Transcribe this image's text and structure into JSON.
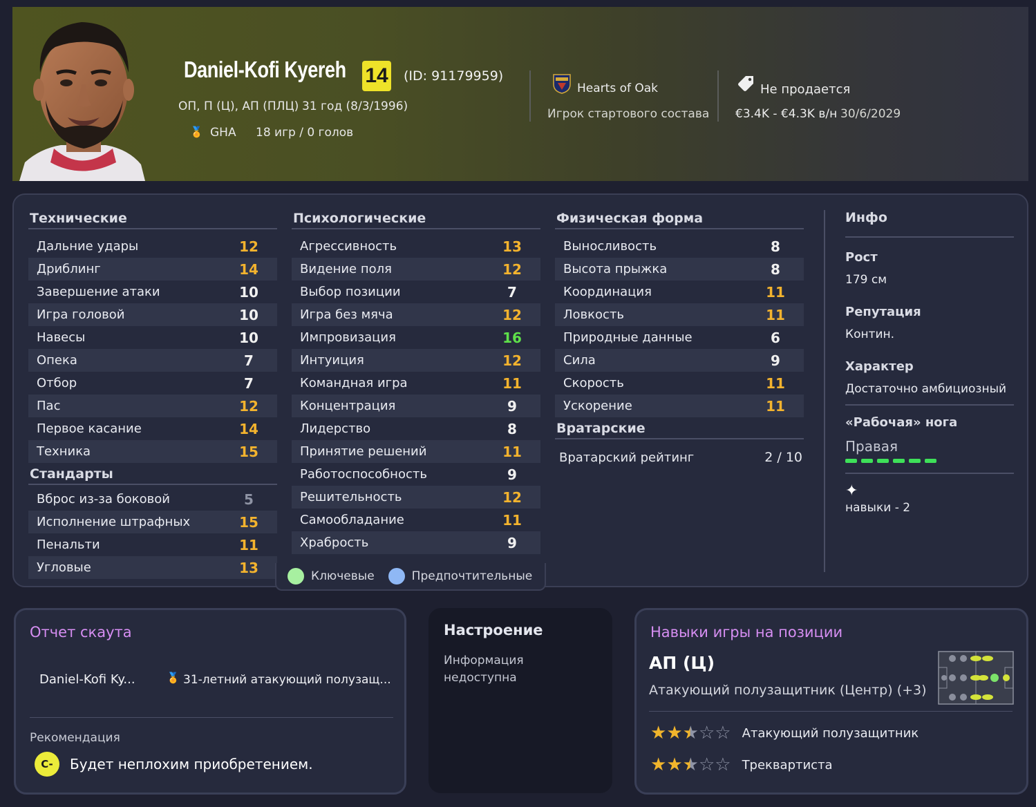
{
  "player": {
    "name": "Daniel-Kofi Kyereh",
    "number": "14",
    "id": "(ID: 91179959)",
    "positions": "ОП, П (Ц), АП (ПЛЦ)",
    "age": "31 год (8/3/1996)",
    "nation": "GHA",
    "caps": "18 игр / 0 голов"
  },
  "club": {
    "name": "Hearts of Oak",
    "squad_status": "Игрок стартового состава"
  },
  "transfer": {
    "status": "Не продается",
    "wage": "€3.4K - €4.3K  в/н",
    "contract": "30/6/2029"
  },
  "technical": {
    "title": "Технические",
    "rows": [
      {
        "label": "Дальние удары",
        "value": "12",
        "tone": "y"
      },
      {
        "label": "Дриблинг",
        "value": "14",
        "tone": "y"
      },
      {
        "label": "Завершение атаки",
        "value": "10",
        "tone": "w"
      },
      {
        "label": "Игра головой",
        "value": "10",
        "tone": "w"
      },
      {
        "label": "Навесы",
        "value": "10",
        "tone": "w"
      },
      {
        "label": "Опека",
        "value": "7",
        "tone": "w"
      },
      {
        "label": "Отбор",
        "value": "7",
        "tone": "w"
      },
      {
        "label": "Пас",
        "value": "12",
        "tone": "y"
      },
      {
        "label": "Первое касание",
        "value": "14",
        "tone": "y"
      },
      {
        "label": "Техника",
        "value": "15",
        "tone": "y"
      }
    ]
  },
  "set_pieces": {
    "title": "Стандарты",
    "rows": [
      {
        "label": "Вброс из-за боковой",
        "value": "5",
        "tone": "gr"
      },
      {
        "label": "Исполнение штрафных",
        "value": "15",
        "tone": "y"
      },
      {
        "label": "Пенальти",
        "value": "11",
        "tone": "y"
      },
      {
        "label": "Угловые",
        "value": "13",
        "tone": "y"
      }
    ]
  },
  "mental": {
    "title": "Психологические",
    "rows": [
      {
        "label": "Агрессивность",
        "value": "13",
        "tone": "y"
      },
      {
        "label": "Видение поля",
        "value": "12",
        "tone": "y"
      },
      {
        "label": "Выбор позиции",
        "value": "7",
        "tone": "w"
      },
      {
        "label": "Игра без мяча",
        "value": "12",
        "tone": "y"
      },
      {
        "label": "Импровизация",
        "value": "16",
        "tone": "g"
      },
      {
        "label": "Интуиция",
        "value": "12",
        "tone": "y"
      },
      {
        "label": "Командная игра",
        "value": "11",
        "tone": "y"
      },
      {
        "label": "Концентрация",
        "value": "9",
        "tone": "w"
      },
      {
        "label": "Лидерство",
        "value": "8",
        "tone": "w"
      },
      {
        "label": "Принятие решений",
        "value": "11",
        "tone": "y"
      },
      {
        "label": "Работоспособность",
        "value": "9",
        "tone": "w"
      },
      {
        "label": "Решительность",
        "value": "12",
        "tone": "y"
      },
      {
        "label": "Самообладание",
        "value": "11",
        "tone": "y"
      },
      {
        "label": "Храбрость",
        "value": "9",
        "tone": "w"
      }
    ]
  },
  "physical": {
    "title": "Физическая форма",
    "rows": [
      {
        "label": "Выносливость",
        "value": "8",
        "tone": "w"
      },
      {
        "label": "Высота прыжка",
        "value": "8",
        "tone": "w"
      },
      {
        "label": "Координация",
        "value": "11",
        "tone": "y"
      },
      {
        "label": "Ловкость",
        "value": "11",
        "tone": "y"
      },
      {
        "label": "Природные данные",
        "value": "6",
        "tone": "w"
      },
      {
        "label": "Сила",
        "value": "9",
        "tone": "w"
      },
      {
        "label": "Скорость",
        "value": "11",
        "tone": "y"
      },
      {
        "label": "Ускорение",
        "value": "11",
        "tone": "y"
      }
    ]
  },
  "goalkeeping": {
    "title": "Вратарские",
    "label": "Вратарский рейтинг",
    "value": "2 / 10"
  },
  "info": {
    "title": "Инфо",
    "height_label": "Рост",
    "height": "179 см",
    "reputation_label": "Репутация",
    "reputation": "Контин.",
    "personality_label": "Характер",
    "personality": "Достаточно амбициозный",
    "foot_label": "«Рабочая» нога",
    "foot": "Правая",
    "traits": "навыки - 2"
  },
  "legend": {
    "key": "Ключевые",
    "preferred": "Предпочтительные",
    "key_color": "#a7f0a0",
    "preferred_color": "#8fb8f5"
  },
  "scout": {
    "title": "Отчет скаута",
    "name": "Daniel-Kofi Ky...",
    "summary": "31-летний атакующий полузащ...",
    "recommendation_label": "Рекомендация",
    "grade": "C-",
    "recommendation": "Будет неплохим приобретением."
  },
  "mood": {
    "title": "Настроение",
    "line1": "Информация",
    "line2": "недоступна"
  },
  "position_skills": {
    "title": "Навыки игры на позиции",
    "position": "АП (Ц)",
    "position_full": "Атакующий полузащитник (Центр) (+3)",
    "roles": [
      {
        "name": "Атакующий полузащитник",
        "stars": 2.5
      },
      {
        "name": "Треквартиста",
        "stars": 2.5
      }
    ]
  },
  "colors": {
    "accent_pink": "#d68ef2",
    "attr_high": "#f3b32e",
    "attr_top": "#5ee04a",
    "number_badge": "#eee229"
  }
}
